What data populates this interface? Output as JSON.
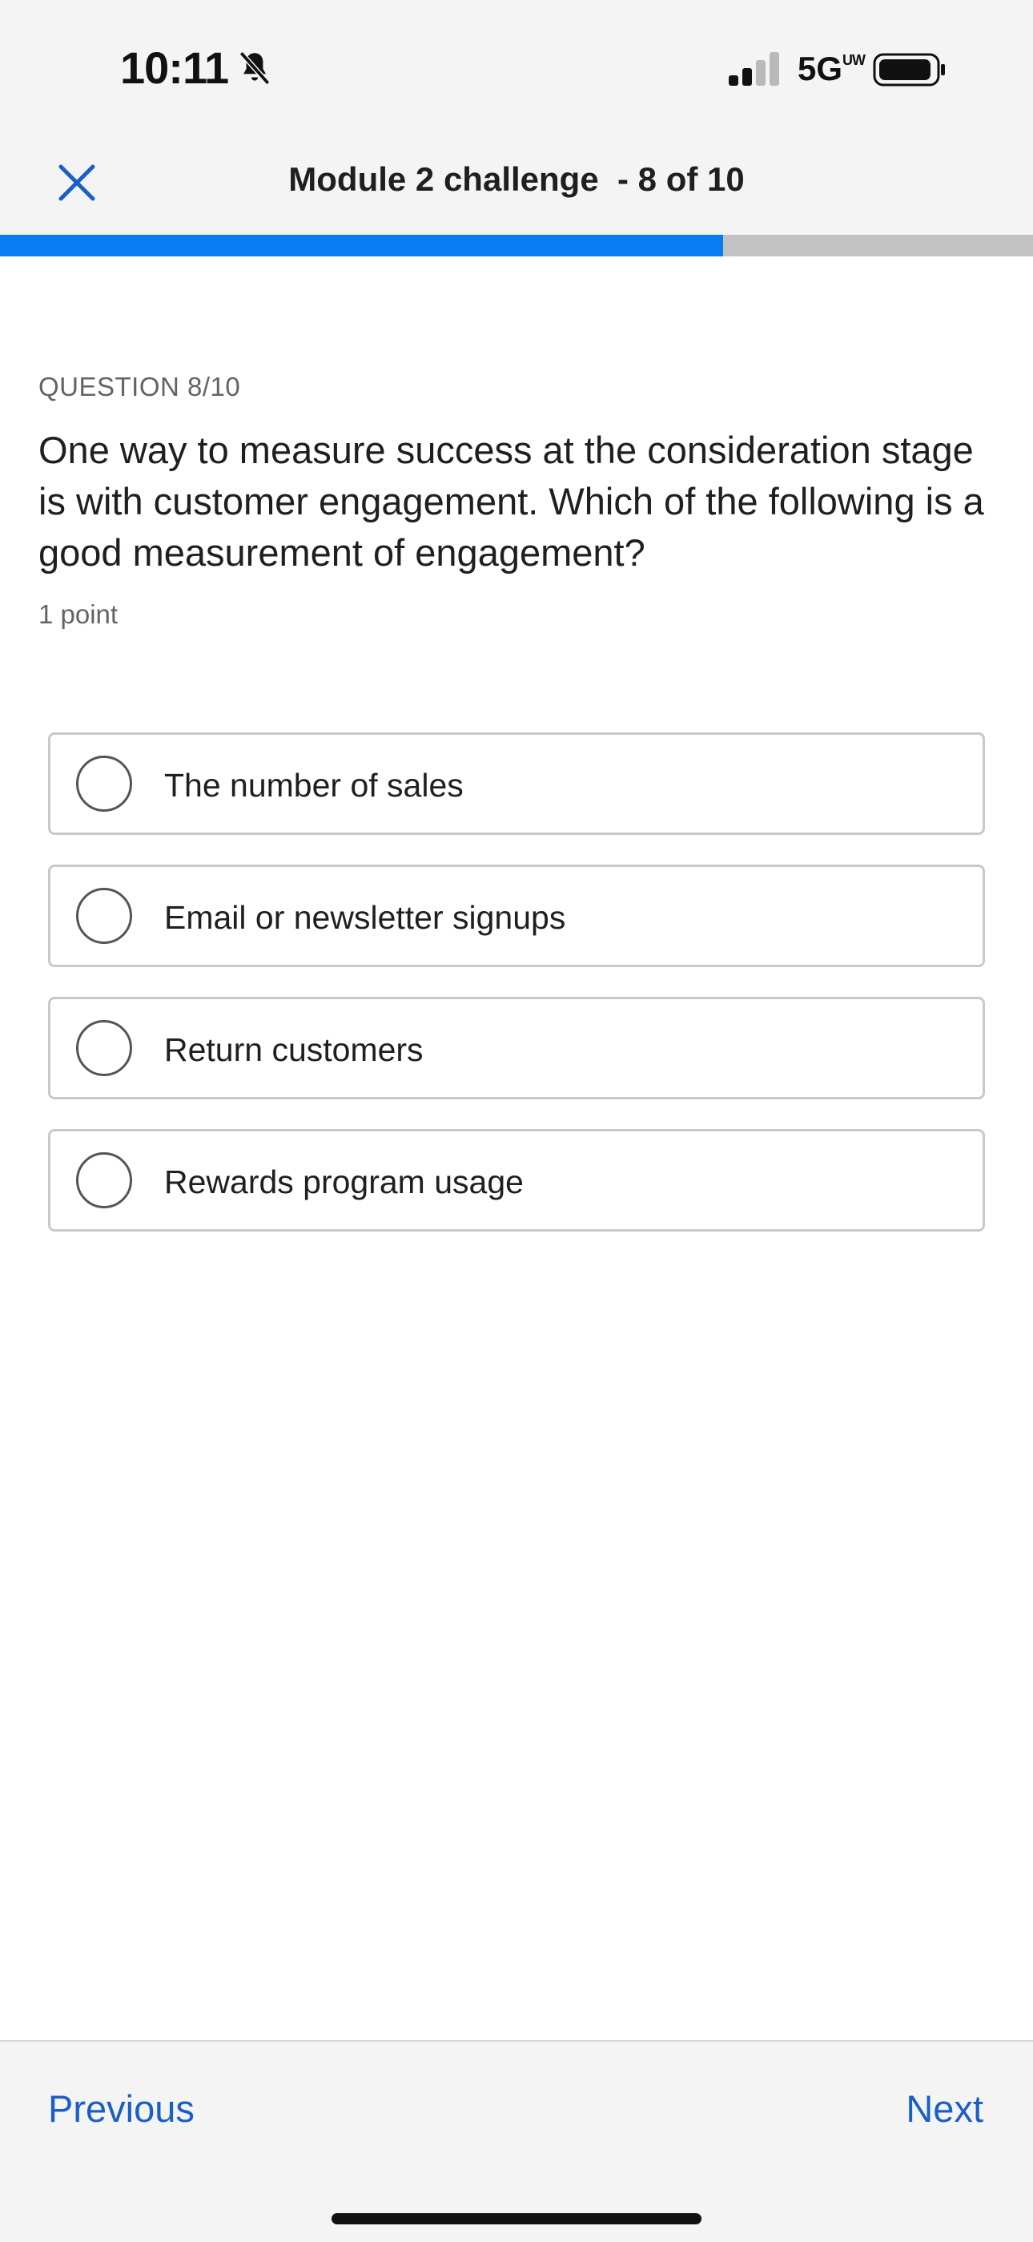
{
  "status_bar": {
    "time": "10:11",
    "network": "5G",
    "network_superscript": "UW",
    "icons": [
      "bell-slash-icon",
      "signal-icon",
      "battery-icon"
    ]
  },
  "header": {
    "close_icon": "close-icon",
    "title": "Module 2 challenge  - 8 of 10"
  },
  "progress": {
    "fraction": 0.7,
    "fill_color": "#0a7cf2",
    "track_color": "#c2c2c2"
  },
  "question": {
    "label": "QUESTION 8/10",
    "text": "One way to measure success at the consideration stage is with customer engagement. Which of the following is a good measurement of engagement?",
    "points": "1 point"
  },
  "options": [
    {
      "label": "The number of sales",
      "selected": false
    },
    {
      "label": "Email or newsletter signups",
      "selected": false
    },
    {
      "label": "Return customers",
      "selected": false
    },
    {
      "label": "Rewards program usage",
      "selected": false
    }
  ],
  "footer": {
    "previous_label": "Previous",
    "next_label": "Next",
    "link_color": "#1a5fc7"
  }
}
